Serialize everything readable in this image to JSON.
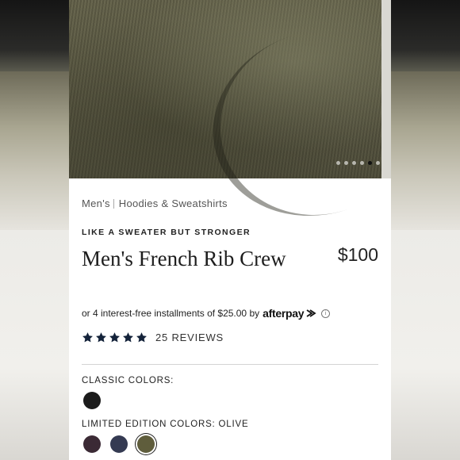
{
  "product": {
    "breadcrumb": [
      "Men's",
      "Hoodies & Sweatshirts"
    ],
    "tagline": "LIKE A SWEATER BUT STRONGER",
    "title": "Men's French Rib Crew",
    "price": "$100",
    "installment_prefix": "or 4 interest-free installments of $25.00 by",
    "afterpay_label": "afterpay",
    "rating_stars": 5,
    "reviews_label": "25 REVIEWS"
  },
  "gallery": {
    "dot_count": 6,
    "active_dot": 5
  },
  "colors": {
    "classic_label": "CLASSIC COLORS:",
    "classic": [
      {
        "name": "black",
        "hex": "#1b1b1b"
      }
    ],
    "limited_label": "LIMITED EDITION COLORS: OLIVE",
    "limited": [
      {
        "name": "plum",
        "hex": "#3b2a35"
      },
      {
        "name": "navy",
        "hex": "#343a52"
      },
      {
        "name": "olive",
        "hex": "#5f5d3c",
        "selected": true
      }
    ]
  },
  "theme": {
    "star_color": "#14233a",
    "text_color": "#222222"
  }
}
